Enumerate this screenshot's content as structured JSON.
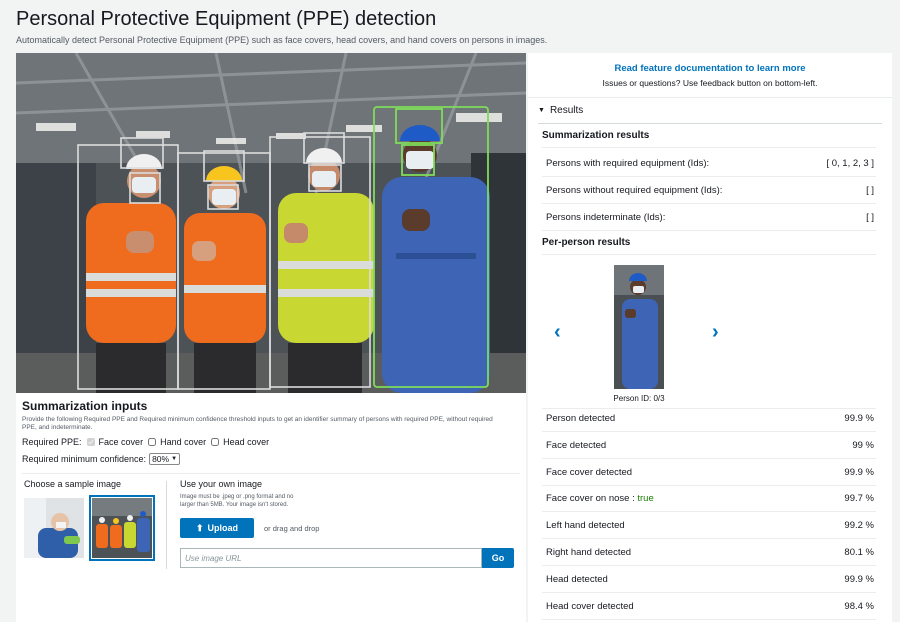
{
  "header": {
    "title": "Personal Protective Equipment (PPE) detection",
    "subtitle": "Automatically detect Personal Protective Equipment (PPE) such as face covers, head covers, and hand covers on persons in images."
  },
  "inputs": {
    "title": "Summarization inputs",
    "description": "Provide the following Required PPE and Required minimum confidence threshold inputs to get an identifier summary of persons with required PPE, without required PPE, and indeterminate.",
    "required_ppe_label": "Required PPE:",
    "ppe_options": [
      {
        "label": "Face cover",
        "checked": true
      },
      {
        "label": "Hand cover",
        "checked": false
      },
      {
        "label": "Head cover",
        "checked": false
      }
    ],
    "confidence_label": "Required minimum confidence:",
    "confidence_value": "80%"
  },
  "samples": {
    "label": "Choose a sample image"
  },
  "own_image": {
    "label": "Use your own image",
    "note": "Image must be .jpeg or .png format and no larger than 5MB. Your image isn't stored.",
    "upload_label": "Upload",
    "drag_text": "or drag and drop",
    "url_placeholder": "Use image URL",
    "go_label": "Go"
  },
  "doc": {
    "link": "Read feature documentation to learn more",
    "sub": "Issues or questions? Use feedback button on bottom-left."
  },
  "results": {
    "header": "Results",
    "summary_title": "Summarization results",
    "summary": [
      {
        "label": "Persons with required equipment (Ids):",
        "value": "[ 0, 1, 2, 3 ]"
      },
      {
        "label": "Persons without required equipment (Ids):",
        "value": "[ ]"
      },
      {
        "label": "Persons indeterminate (Ids):",
        "value": "[ ]"
      }
    ],
    "per_person_title": "Per-person results",
    "person_id": "Person ID: 0/3",
    "per_person": [
      {
        "label": "Person detected",
        "value": "99.9 %"
      },
      {
        "label": "Face detected",
        "value": "99 %"
      },
      {
        "label": "Face cover detected",
        "value": "99.9 %"
      },
      {
        "label": "Face cover on nose : ",
        "extra": "true",
        "value": "99.7 %"
      },
      {
        "label": "Left hand detected",
        "value": "99.2 %"
      },
      {
        "label": "Right hand detected",
        "value": "80.1 %"
      },
      {
        "label": "Head detected",
        "value": "99.9 %"
      },
      {
        "label": "Head cover detected",
        "value": "98.4 %"
      }
    ]
  },
  "colors": {
    "accent": "#0073bb",
    "selected_box": "#7fdc5a",
    "box": "#dcdcdc"
  }
}
